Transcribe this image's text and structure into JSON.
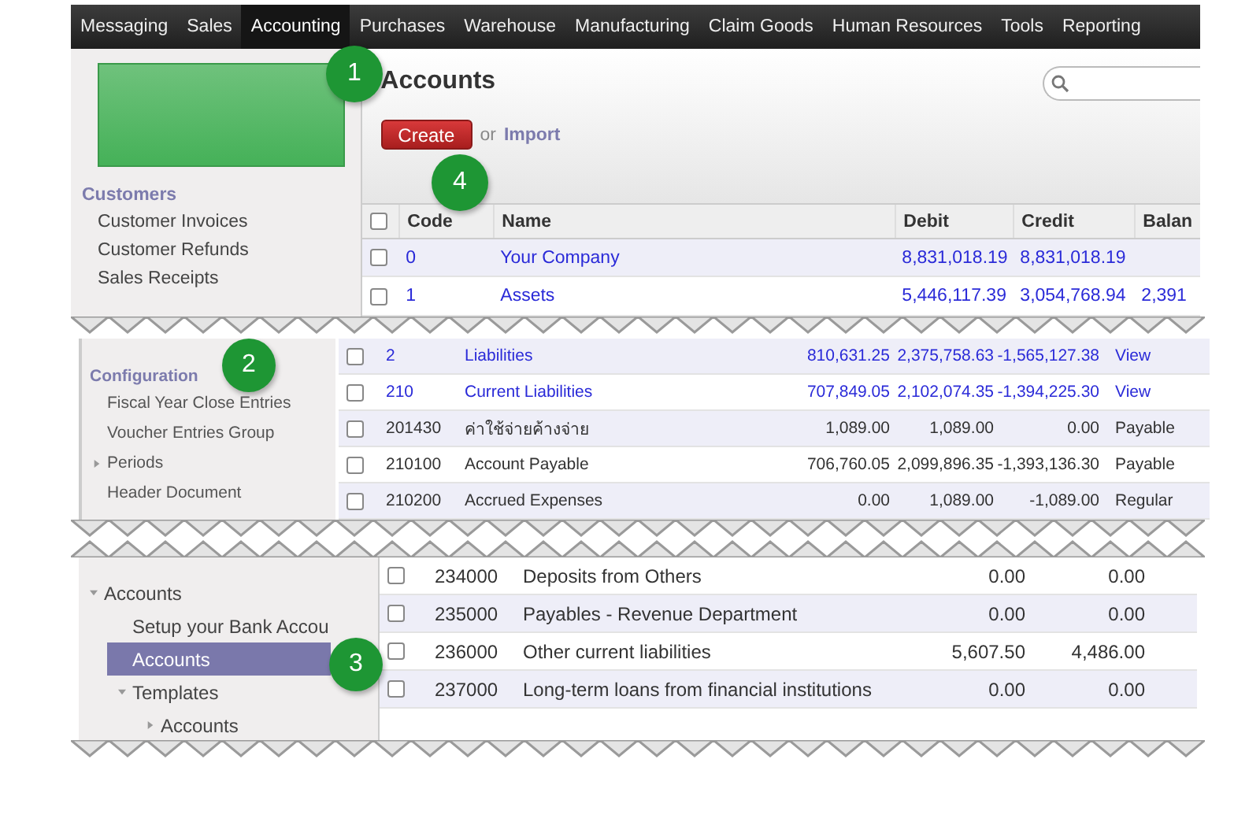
{
  "navbar": {
    "items": [
      {
        "label": "Messaging",
        "selected": false
      },
      {
        "label": "Sales",
        "selected": false
      },
      {
        "label": "Accounting",
        "selected": true
      },
      {
        "label": "Purchases",
        "selected": false
      },
      {
        "label": "Warehouse",
        "selected": false
      },
      {
        "label": "Manufacturing",
        "selected": false
      },
      {
        "label": "Claim Goods",
        "selected": false
      },
      {
        "label": "Human Resources",
        "selected": false
      },
      {
        "label": "Tools",
        "selected": false
      },
      {
        "label": "Reporting",
        "selected": false
      }
    ]
  },
  "screen_1": {
    "sidebar": {
      "section": "Customers",
      "items": [
        "Customer Invoices",
        "Customer Refunds",
        "Sales Receipts"
      ]
    },
    "title": "Accounts",
    "create_button": "Create",
    "or_text": "or",
    "import_link": "Import",
    "table": {
      "columns": [
        "Code",
        "Name",
        "Debit",
        "Credit",
        "Balan"
      ],
      "header_checked": false,
      "rows": [
        {
          "code": "0",
          "name": "Your Company",
          "debit": "8,831,018.19",
          "credit": "8,831,018.19",
          "checked": false,
          "link": true
        },
        {
          "code": "1",
          "name": "Assets",
          "debit": "5,446,117.39",
          "credit": "3,054,768.94",
          "balance": "2,391",
          "checked": false,
          "link": true
        }
      ]
    }
  },
  "screen_2": {
    "sidebar": {
      "section": "Configuration",
      "items": [
        {
          "label": "Fiscal Year Close Entries"
        },
        {
          "label": "Voucher Entries Group"
        },
        {
          "label": "Periods",
          "expanded": false
        },
        {
          "label": "Header Document"
        }
      ]
    },
    "rows": [
      {
        "code": "2",
        "name": "Liabilities",
        "debit": "810,631.25",
        "credit": "2,375,758.63",
        "balance": "-1,565,127.38",
        "type": "View",
        "checked": false,
        "link": true
      },
      {
        "code": "210",
        "name": "Current Liabilities",
        "debit": "707,849.05",
        "credit": "2,102,074.35",
        "balance": "-1,394,225.30",
        "type": "View",
        "checked": false,
        "link": true
      },
      {
        "code": "201430",
        "name": "ค่าใช้จ่ายค้างจ่าย",
        "debit": "1,089.00",
        "credit": "1,089.00",
        "balance": "0.00",
        "type": "Payable",
        "checked": false,
        "link": false
      },
      {
        "code": "210100",
        "name": "Account Payable",
        "debit": "706,760.05",
        "credit": "2,099,896.35",
        "balance": "-1,393,136.30",
        "type": "Payable",
        "checked": false,
        "link": false
      },
      {
        "code": "210200",
        "name": "Accrued Expenses",
        "debit": "0.00",
        "credit": "1,089.00",
        "balance": "-1,089.00",
        "type": "Regular",
        "checked": false,
        "link": false
      }
    ]
  },
  "screen_3": {
    "sidebar": {
      "items": [
        {
          "label": "Accounts",
          "expanded": true,
          "selected": false,
          "children": [
            {
              "label": "Setup your Bank Accou",
              "selected": false
            },
            {
              "label": "Accounts",
              "selected": true
            },
            {
              "label": "Templates",
              "expanded": true,
              "selected": false,
              "children": [
                {
                  "label": "Accounts",
                  "expanded": false,
                  "selected": false
                }
              ]
            }
          ]
        }
      ]
    },
    "rows": [
      {
        "code": "234000",
        "name": "Deposits from Others",
        "debit": "0.00",
        "credit": "0.00",
        "checked": false
      },
      {
        "code": "235000",
        "name": "Payables - Revenue Department",
        "debit": "0.00",
        "credit": "0.00",
        "checked": false
      },
      {
        "code": "236000",
        "name": "Other current liabilities",
        "debit": "5,607.50",
        "credit": "4,486.00",
        "checked": false
      },
      {
        "code": "237000",
        "name": "Long-term loans from financial institutions",
        "debit": "0.00",
        "credit": "0.00",
        "checked": false
      }
    ]
  },
  "callouts": [
    "1",
    "4",
    "2",
    "3"
  ]
}
